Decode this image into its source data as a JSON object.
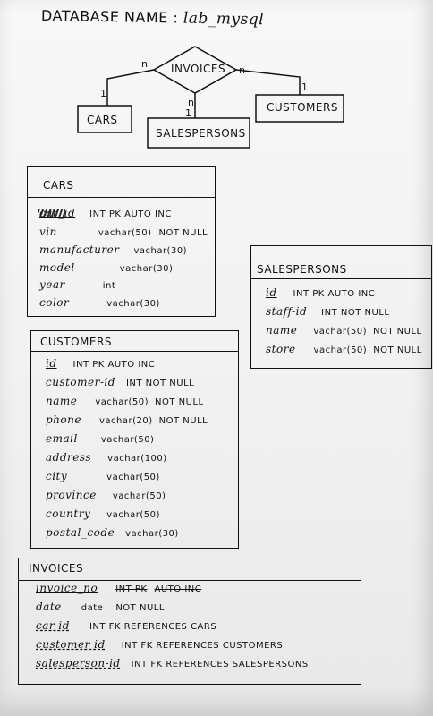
{
  "diagram": {
    "title_prefix": "DATABASE NAME :",
    "database_name": "lab_mysql",
    "er": {
      "invoices": "INVOICES",
      "cars": "CARS",
      "customers": "CUSTOMERS",
      "salespersons": "SALESPERSONS",
      "card_invoice_cars": "n",
      "card_cars": "1",
      "card_invoice_customers": "n",
      "card_customers": "1",
      "card_invoice_salespersons": "n",
      "card_salespersons": "1"
    },
    "cars": {
      "title": "CARS",
      "fields": [
        {
          "name": "car_id",
          "type": "INT PK AUTO INC",
          "flags": ""
        },
        {
          "name": "vin",
          "type": "vachar(50)",
          "flags": "NOT NULL"
        },
        {
          "name": "manufacturer",
          "type": "vachar(30)",
          "flags": ""
        },
        {
          "name": "model",
          "type": "vachar(30)",
          "flags": ""
        },
        {
          "name": "year",
          "type": "int",
          "flags": ""
        },
        {
          "name": "color",
          "type": "vachar(30)",
          "flags": ""
        }
      ]
    },
    "salespersons": {
      "title": "SALESPERSONS",
      "fields": [
        {
          "name": "id",
          "type": "INT PK AUTO INC",
          "flags": ""
        },
        {
          "name": "staff-id",
          "type": "INT NOT NULL",
          "flags": ""
        },
        {
          "name": "name",
          "type": "vachar(50)",
          "flags": "NOT NULL"
        },
        {
          "name": "store",
          "type": "vachar(50)",
          "flags": "NOT NULL"
        }
      ]
    },
    "customers": {
      "title": "CUSTOMERS",
      "fields": [
        {
          "name": "id",
          "type": "INT PK AUTO INC",
          "flags": ""
        },
        {
          "name": "customer-id",
          "type": "INT NOT NULL",
          "flags": ""
        },
        {
          "name": "name",
          "type": "vachar(50)",
          "flags": "NOT NULL"
        },
        {
          "name": "phone",
          "type": "vachar(20)",
          "flags": "NOT NULL"
        },
        {
          "name": "email",
          "type": "vachar(50)",
          "flags": ""
        },
        {
          "name": "address",
          "type": "vachar(100)",
          "flags": ""
        },
        {
          "name": "city",
          "type": "vachar(50)",
          "flags": ""
        },
        {
          "name": "province",
          "type": "vachar(50)",
          "flags": ""
        },
        {
          "name": "country",
          "type": "vachar(50)",
          "flags": ""
        },
        {
          "name": "postal_code",
          "type": "vachar(30)",
          "flags": ""
        }
      ]
    },
    "invoices": {
      "title": "INVOICES",
      "fields": [
        {
          "name": "invoice_no",
          "type": "INT PK",
          "flags": "AUTO INC"
        },
        {
          "name": "date",
          "type": "date",
          "flags": "NOT NULL"
        },
        {
          "name": "car id",
          "type": "INT FK REFERENCES CARS",
          "flags": ""
        },
        {
          "name": "customer id",
          "type": "INT FK REFERENCES CUSTOMERS",
          "flags": ""
        },
        {
          "name": "salesperson-id",
          "type": "INT FK REFERENCES SALESPERSONS",
          "flags": ""
        }
      ]
    }
  }
}
